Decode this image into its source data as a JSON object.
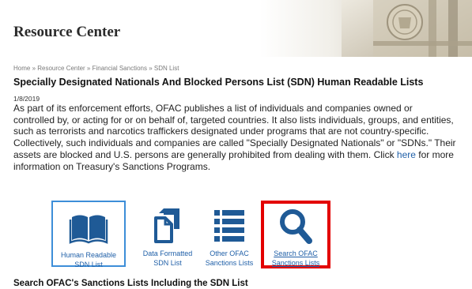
{
  "banner": {
    "title": "Resource Center"
  },
  "breadcrumb": "Home » Resource Center » Financial Sanctions » SDN List",
  "heading": "Specially Designated Nationals And Blocked Persons List (SDN) Human Readable Lists",
  "date": "1/8/2019",
  "body": {
    "text_before_link": "As part of its enforcement efforts, OFAC publishes a list of individuals and companies owned or controlled by, or acting for or on behalf of, targeted countries. It also lists individuals, groups, and entities, such as terrorists and narcotics traffickers designated under programs that are not country-specific. Collectively, such individuals and companies are called \"Specially Designated Nationals\" or \"SDNs.\" Their assets are blocked and U.S. persons are generally prohibited from dealing with them.  Click ",
    "link_text": "here",
    "text_after_link": " for more information on Treasury's Sanctions Programs."
  },
  "tiles": [
    {
      "label_line1": "Human Readable",
      "label_line2": "SDN List",
      "icon": "open-book-icon"
    },
    {
      "label_line1": "Data Formatted",
      "label_line2": "SDN List",
      "icon": "documents-icon"
    },
    {
      "label_line1": "Other OFAC",
      "label_line2": "Sanctions Lists",
      "icon": "list-icon"
    },
    {
      "label_line1": "Search OFAC",
      "label_line2": "Sanctions Lists",
      "icon": "search-icon"
    }
  ],
  "bottom_heading": "Search OFAC's Sanctions Lists Including the SDN List",
  "colors": {
    "icon_blue": "#1f5a96",
    "link_blue": "#2060a8",
    "highlight_red": "#e30000",
    "selected_border": "#3d8ed8"
  }
}
